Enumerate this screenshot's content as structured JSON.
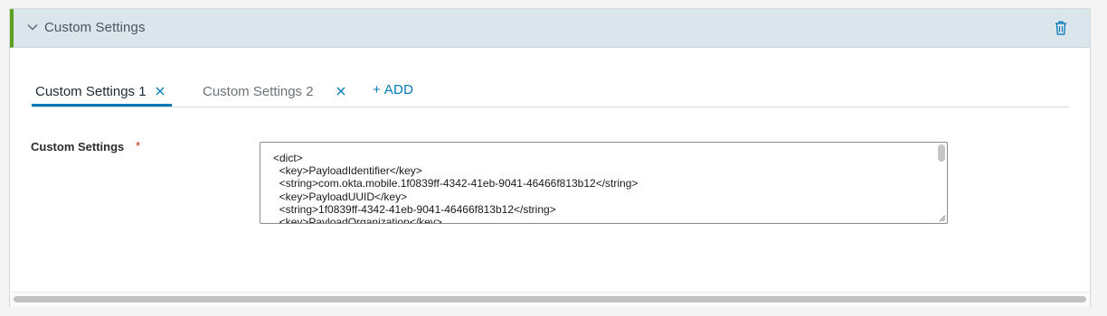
{
  "panel": {
    "title": "Custom Settings",
    "icons": {
      "collapse": "chevron-down-icon",
      "delete": "trash-icon"
    },
    "accent_color": "#5aa220"
  },
  "tabs": {
    "items": [
      {
        "label": "Custom Settings 1",
        "active": true
      },
      {
        "label": "Custom Settings 2",
        "active": false
      }
    ],
    "add_label": "+ ADD",
    "accent_color": "#0079b8"
  },
  "field": {
    "label": "Custom Settings",
    "required_marker": "*",
    "value": "<dict>\n  <key>PayloadIdentifier</key>\n  <string>com.okta.mobile.1f0839ff-4342-41eb-9041-46466f813b12</string>\n  <key>PayloadUUID</key>\n  <string>1f0839ff-4342-41eb-9041-46466f813b12</string>\n  <key>PayloadOrganization</key>"
  }
}
